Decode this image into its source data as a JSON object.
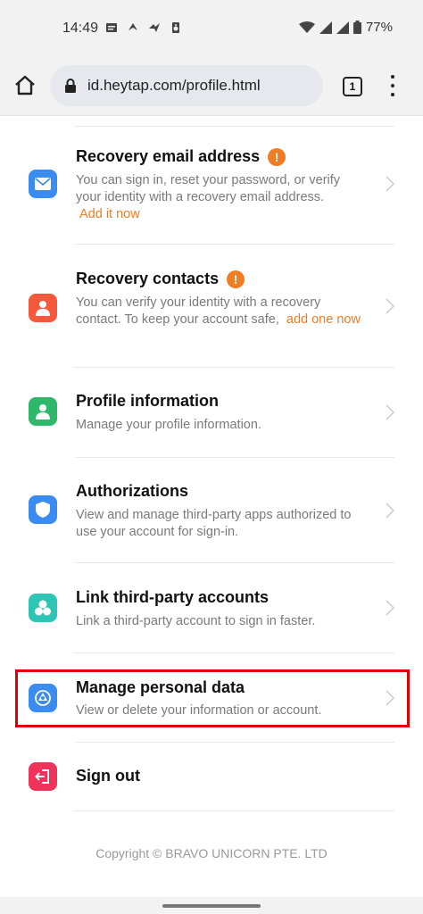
{
  "status": {
    "time": "14:49",
    "battery": "77%"
  },
  "browser": {
    "url": "id.heytap.com/profile.html",
    "tab_count": "1"
  },
  "items": [
    {
      "title": "Recovery email address",
      "desc": "You can sign in, reset your password, or verify your identity with a recovery email address.",
      "link": "Add it now",
      "icon": "email-icon",
      "color": "#3b8cf0"
    },
    {
      "title": "Recovery contacts",
      "desc": "You can verify your identity with a recovery contact. To keep your account safe,",
      "link": "add one now",
      "icon": "contact-icon",
      "color": "#f4593b"
    },
    {
      "title": "Profile information",
      "desc": "Manage your profile information.",
      "icon": "person-icon",
      "color": "#2eb86a"
    },
    {
      "title": "Authorizations",
      "desc": "View and manage third-party apps authorized to use your account for sign-in.",
      "icon": "shield-icon",
      "color": "#3b8cf0"
    },
    {
      "title": "Link third-party accounts",
      "desc": "Link a third-party account to sign in faster.",
      "icon": "link-accounts-icon",
      "color": "#2ec4b6"
    },
    {
      "title": "Manage personal data",
      "desc": "View or delete your information or account.",
      "icon": "data-icon",
      "color": "#3b8cf0"
    },
    {
      "title": "Sign out",
      "icon": "sign-out-icon",
      "color": "#f0335a"
    }
  ],
  "footer": {
    "copyright": "Copyright © BRAVO UNICORN PTE. LTD"
  },
  "colors": {
    "accent": "#f07c24",
    "highlight": "#e00000"
  }
}
